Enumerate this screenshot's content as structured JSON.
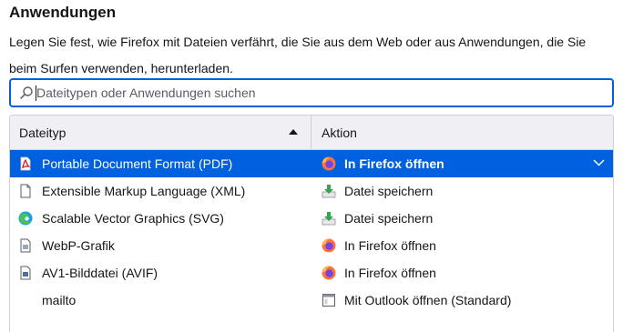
{
  "section": {
    "title": "Anwendungen",
    "description": "Legen Sie fest, wie Firefox mit Dateien verfährt, die Sie aus dem Web oder aus Anwendungen, die Sie beim Surfen verwenden, herunterladen."
  },
  "search": {
    "placeholder": "Dateitypen oder Anwendungen suchen",
    "icon": "search-icon"
  },
  "table": {
    "columns": [
      "Dateityp",
      "Aktion"
    ],
    "sort_column": "Dateityp",
    "sort_direction": "ascending",
    "rows": [
      {
        "type": "Portable Document Format (PDF)",
        "type_icon": "pdf-icon",
        "action": "In Firefox öffnen",
        "action_icon": "firefox-icon",
        "selected": true
      },
      {
        "type": "Extensible Markup Language (XML)",
        "type_icon": "document-icon",
        "action": "Datei speichern",
        "action_icon": "download-icon",
        "selected": false
      },
      {
        "type": "Scalable Vector Graphics (SVG)",
        "type_icon": "edge-icon",
        "action": "Datei speichern",
        "action_icon": "download-icon",
        "selected": false
      },
      {
        "type": "WebP-Grafik",
        "type_icon": "image-file-icon",
        "action": "In Firefox öffnen",
        "action_icon": "firefox-icon",
        "selected": false
      },
      {
        "type": "AV1-Bilddatei (AVIF)",
        "type_icon": "image-file-icon",
        "action": "In Firefox öffnen",
        "action_icon": "firefox-icon",
        "selected": false
      },
      {
        "type": "mailto",
        "type_icon": "",
        "action": "Mit Outlook öffnen (Standard)",
        "action_icon": "application-icon",
        "selected": false
      }
    ]
  },
  "colors": {
    "accent": "#0061e0",
    "header_bg": "#f0f0f4",
    "border": "#cfcfd8"
  }
}
